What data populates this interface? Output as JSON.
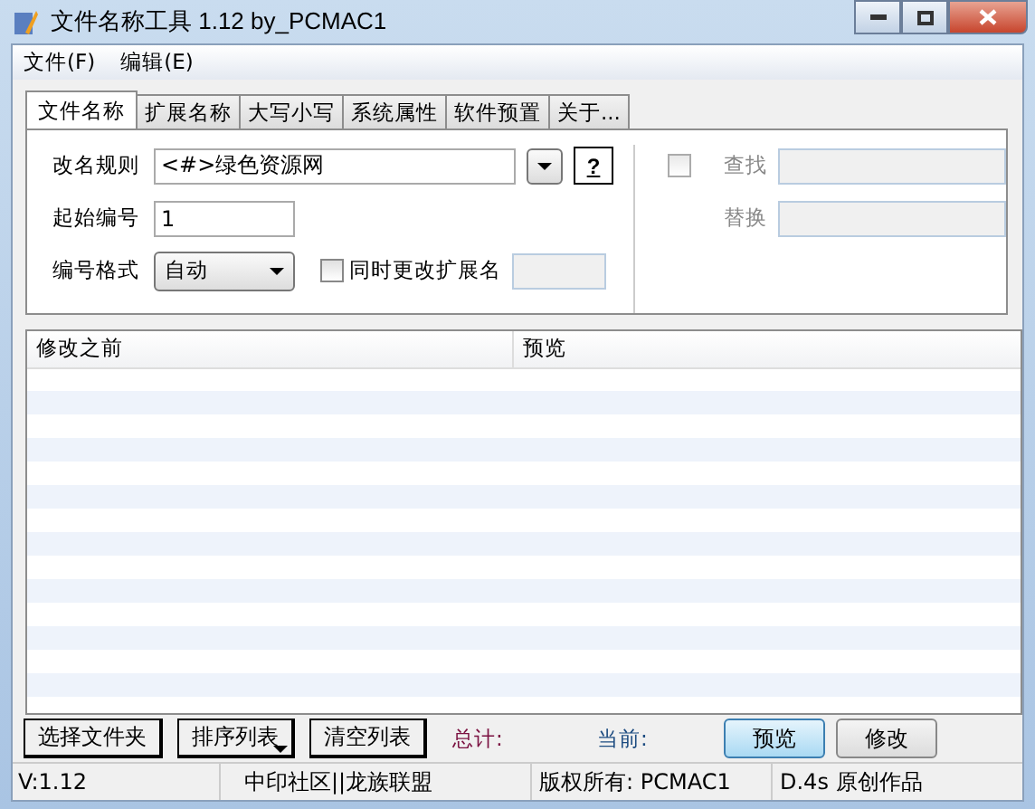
{
  "window": {
    "title": "文件名称工具 1.12  by_PCMAC1"
  },
  "menu": [
    "文件(F)",
    "编辑(E)"
  ],
  "tabs": [
    {
      "label": "文件名称",
      "selected": true
    },
    {
      "label": "扩展名称",
      "selected": false
    },
    {
      "label": "大写小写",
      "selected": false
    },
    {
      "label": "系统属性",
      "selected": false
    },
    {
      "label": "软件预置",
      "selected": false
    },
    {
      "label": "关于...",
      "selected": false
    }
  ],
  "rule": {
    "label": "改名规则",
    "value": "<#>绿色资源网",
    "help": "?"
  },
  "start": {
    "label": "起始编号",
    "value": "1"
  },
  "format": {
    "label": "编号格式",
    "value": "自动"
  },
  "ext": {
    "label": "同时更改扩展名",
    "checked": false
  },
  "find": {
    "label": "查找",
    "checked": false,
    "disabled": true
  },
  "replace": {
    "label": "替换",
    "disabled": true
  },
  "table": {
    "columns": [
      "修改之前",
      "预览"
    ]
  },
  "buttons": [
    {
      "label": "选择文件夹",
      "kind": "plain"
    },
    {
      "label": "排序列表",
      "kind": "menu"
    },
    {
      "label": "清空列表",
      "kind": "plain"
    }
  ],
  "total": "总计:",
  "current": "当前:",
  "actions": [
    {
      "label": "预览",
      "selected": true
    },
    {
      "label": "修改",
      "selected": false
    }
  ],
  "status_bar": [
    "V:1.12",
    "中印社区||龙族联盟",
    "版权所有: PCMAC1",
    "D.4s 原创作品"
  ]
}
